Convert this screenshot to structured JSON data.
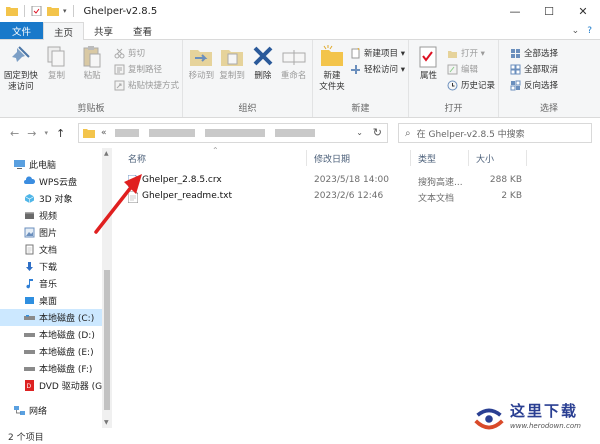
{
  "window": {
    "title": "Ghelper-v2.8.5",
    "minimize": "—",
    "maximize": "☐",
    "close": "✕"
  },
  "tabs": [
    {
      "label": "文件"
    },
    {
      "label": "主页"
    },
    {
      "label": "共享"
    },
    {
      "label": "查看"
    }
  ],
  "ribbon": {
    "clipboard": {
      "label": "剪贴板",
      "pin": "固定到快\n速访问",
      "copy": "复制",
      "paste": "粘贴",
      "copy_path": "复制路径",
      "paste_shortcut": "粘贴快捷方式",
      "cut": "剪切"
    },
    "organize": {
      "label": "组织",
      "move_to": "移动到",
      "copy_to": "复制到",
      "delete": "删除",
      "rename": "重命名"
    },
    "new": {
      "label": "新建",
      "new_folder": "新建\n文件夹",
      "new_item": "新建项目 ▾",
      "easy_access": "轻松访问 ▾"
    },
    "open": {
      "label": "打开",
      "properties": "属性",
      "open": "打开 ▾",
      "edit": "编辑",
      "history": "历史记录"
    },
    "select": {
      "label": "选择",
      "select_all": "全部选择",
      "select_none": "全部取消",
      "invert": "反向选择"
    }
  },
  "address": {
    "prefix": "«",
    "search_placeholder": "在 Ghelper-v2.8.5 中搜索"
  },
  "navpane": {
    "items": [
      {
        "label": "此电脑",
        "icon": "computer-icon"
      },
      {
        "label": "WPS云盘",
        "icon": "cloud-icon"
      },
      {
        "label": "3D 对象",
        "icon": "cube-icon"
      },
      {
        "label": "视频",
        "icon": "video-icon"
      },
      {
        "label": "图片",
        "icon": "picture-icon"
      },
      {
        "label": "文档",
        "icon": "document-icon"
      },
      {
        "label": "下载",
        "icon": "download-icon"
      },
      {
        "label": "音乐",
        "icon": "music-icon"
      },
      {
        "label": "桌面",
        "icon": "desktop-icon"
      },
      {
        "label": "本地磁盘 (C:)",
        "icon": "drive-icon"
      },
      {
        "label": "本地磁盘 (D:)",
        "icon": "drive-icon"
      },
      {
        "label": "本地磁盘 (E:)",
        "icon": "drive-icon"
      },
      {
        "label": "本地磁盘 (F:)",
        "icon": "drive-icon"
      },
      {
        "label": "DVD 驱动器 (G:",
        "icon": "dvd-icon"
      },
      {
        "label": "网络",
        "icon": "network-icon"
      }
    ]
  },
  "filelist": {
    "columns": {
      "name": "名称",
      "date": "修改日期",
      "type": "类型",
      "size": "大小"
    },
    "rows": [
      {
        "name": "Ghelper_2.8.5.crx",
        "date": "2023/5/18 14:00",
        "type": "搜狗高速...",
        "size": "288 KB"
      },
      {
        "name": "Ghelper_readme.txt",
        "date": "2023/2/6 12:46",
        "type": "文本文档",
        "size": "2 KB"
      }
    ]
  },
  "status": {
    "count": "2 个项目"
  },
  "watermark": {
    "text": "这里下载",
    "url": "www.herodown.com"
  },
  "colors": {
    "file_tab": "#1979ca",
    "annotation_arrow": "#e02020",
    "selection": "#cce8ff"
  }
}
